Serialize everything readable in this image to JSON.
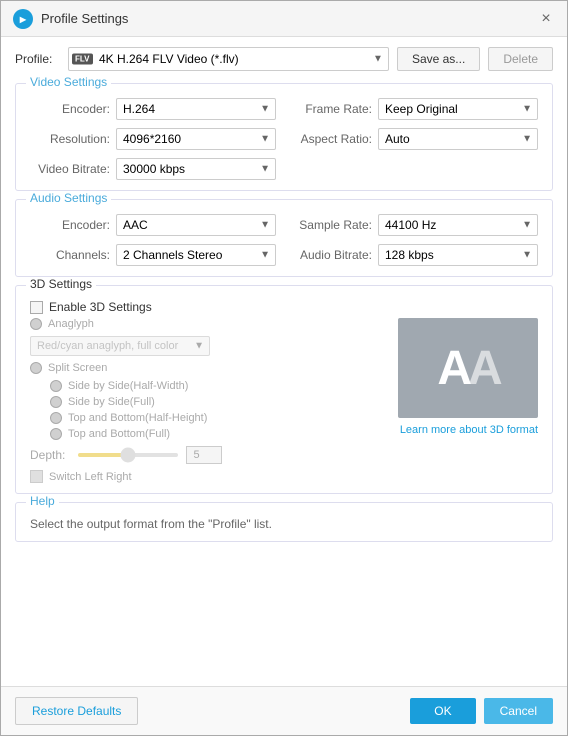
{
  "titleBar": {
    "icon": "FLV",
    "title": "Profile Settings",
    "closeLabel": "×"
  },
  "profile": {
    "label": "Profile:",
    "value": "4K H.264 FLV Video (*.flv)",
    "saveAsLabel": "Save as...",
    "deleteLabel": "Delete"
  },
  "videoSettings": {
    "sectionTitle": "Video Settings",
    "encoderLabel": "Encoder:",
    "encoderValue": "H.264",
    "resolutionLabel": "Resolution:",
    "resolutionValue": "4096*2160",
    "videoBitrateLabel": "Video Bitrate:",
    "videoBitrateValue": "30000 kbps",
    "frameRateLabel": "Frame Rate:",
    "frameRateValue": "Keep Original",
    "aspectRatioLabel": "Aspect Ratio:",
    "aspectRatioValue": "Auto"
  },
  "audioSettings": {
    "sectionTitle": "Audio Settings",
    "encoderLabel": "Encoder:",
    "encoderValue": "AAC",
    "channelsLabel": "Channels:",
    "channelsValue": "2 Channels Stereo",
    "sampleRateLabel": "Sample Rate:",
    "sampleRateValue": "44100 Hz",
    "audioBitrateLabel": "Audio Bitrate:",
    "audioBitrateValue": "128 kbps"
  },
  "threeDSettings": {
    "sectionTitle": "3D Settings",
    "enableLabel": "Enable 3D Settings",
    "anaglyphLabel": "Anaglyph",
    "anaglyphOption": "Red/cyan anaglyph, full color",
    "splitScreenLabel": "Split Screen",
    "splitOptions": [
      "Side by Side(Half-Width)",
      "Side by Side(Full)",
      "Top and Bottom(Half-Height)",
      "Top and Bottom(Full)"
    ],
    "depthLabel": "Depth:",
    "depthValue": "5",
    "switchLabel": "Switch Left Right",
    "learnMore": "Learn more about 3D format",
    "aaPreview": "AA"
  },
  "help": {
    "sectionTitle": "Help",
    "helpText": "Select the output format from the \"Profile\" list."
  },
  "footer": {
    "restoreLabel": "Restore Defaults",
    "okLabel": "OK",
    "cancelLabel": "Cancel"
  }
}
